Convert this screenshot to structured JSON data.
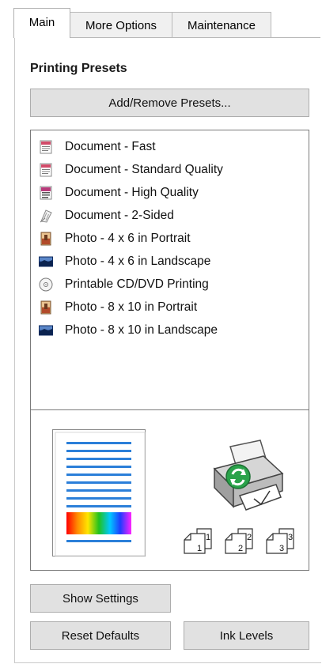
{
  "tabs": [
    {
      "label": "Main",
      "active": true
    },
    {
      "label": "More Options",
      "active": false
    },
    {
      "label": "Maintenance",
      "active": false
    }
  ],
  "presets_section": {
    "title": "Printing Presets",
    "add_remove_label": "Add/Remove Presets..."
  },
  "presets": [
    {
      "label": "Document - Fast",
      "icon": "document-icon"
    },
    {
      "label": "Document - Standard Quality",
      "icon": "document-icon"
    },
    {
      "label": "Document - High Quality",
      "icon": "document-high-quality-icon"
    },
    {
      "label": "Document - 2-Sided",
      "icon": "two-sided-document-icon"
    },
    {
      "label": "Photo - 4 x 6 in Portrait",
      "icon": "photo-portrait-icon"
    },
    {
      "label": "Photo - 4 x 6 in Landscape",
      "icon": "photo-landscape-icon"
    },
    {
      "label": "Printable CD/DVD Printing",
      "icon": "cd-dvd-icon"
    },
    {
      "label": "Photo - 8 x 10 in Portrait",
      "icon": "photo-portrait-icon"
    },
    {
      "label": "Photo - 8 x 10 in Landscape",
      "icon": "photo-landscape-icon"
    }
  ],
  "preview": {
    "page_icon": "page-preview-icon",
    "printer_icon": "printer-icon",
    "copies_icon": "collate-copies-icon",
    "copies_numbers": [
      "1",
      "1",
      "2",
      "2",
      "3",
      "3"
    ]
  },
  "buttons": {
    "show_settings": "Show Settings",
    "reset_defaults": "Reset Defaults",
    "ink_levels": "Ink Levels"
  },
  "colors": {
    "accent_blue": "#2b7fd9",
    "button_face": "#e1e1e1",
    "printer_green": "#2aa24a"
  }
}
